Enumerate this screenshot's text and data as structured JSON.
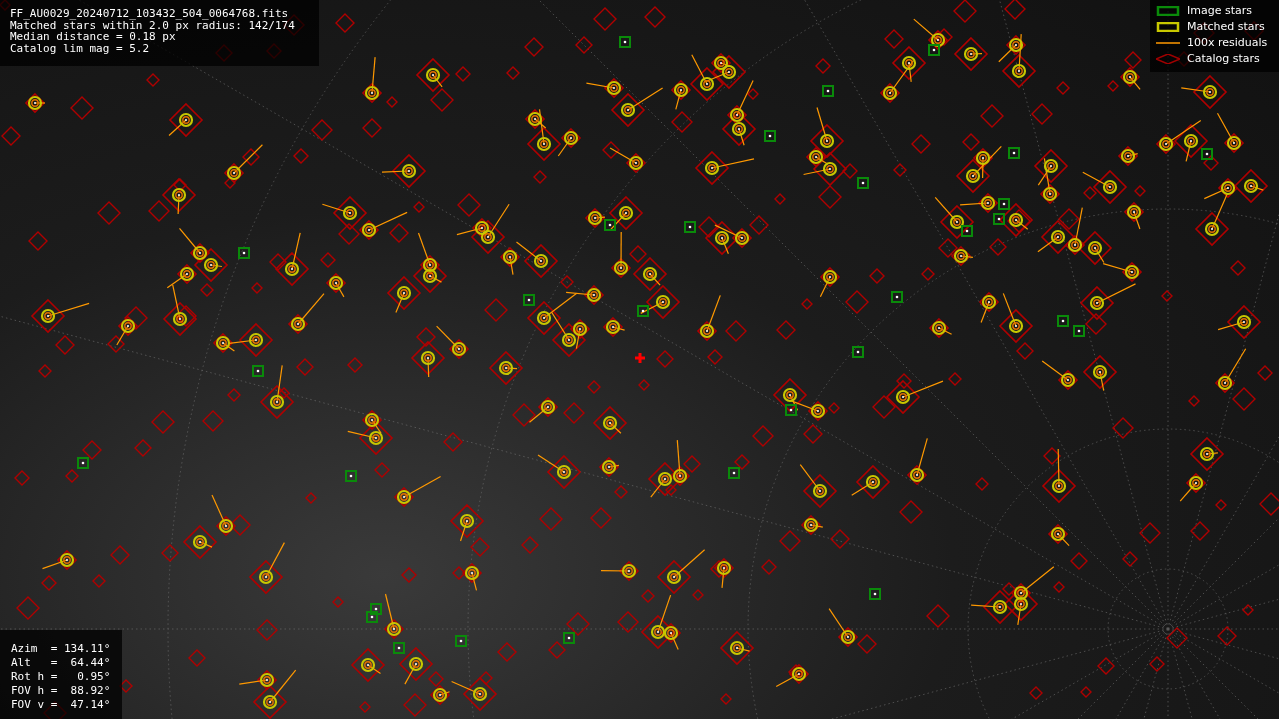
{
  "info_lines": [
    "FF_AU0029_20240712_103432_504_0064768.fits",
    "Matched stars within 2.0 px radius: 142/174",
    "Median distance = 0.18 px",
    "Catalog lim mag = 5.2"
  ],
  "legend": [
    {
      "kind": "image",
      "label": "Image stars"
    },
    {
      "kind": "matched",
      "label": "Matched stars"
    },
    {
      "kind": "residual",
      "label": "100x residuals"
    },
    {
      "kind": "catalog",
      "label": "Catalog stars"
    }
  ],
  "pointing": [
    "Azim  = 134.11°",
    "Alt   =  64.44°",
    "Rot h =   0.95°",
    "FOV h =  88.92°",
    "FOV v =  47.14°"
  ]
}
